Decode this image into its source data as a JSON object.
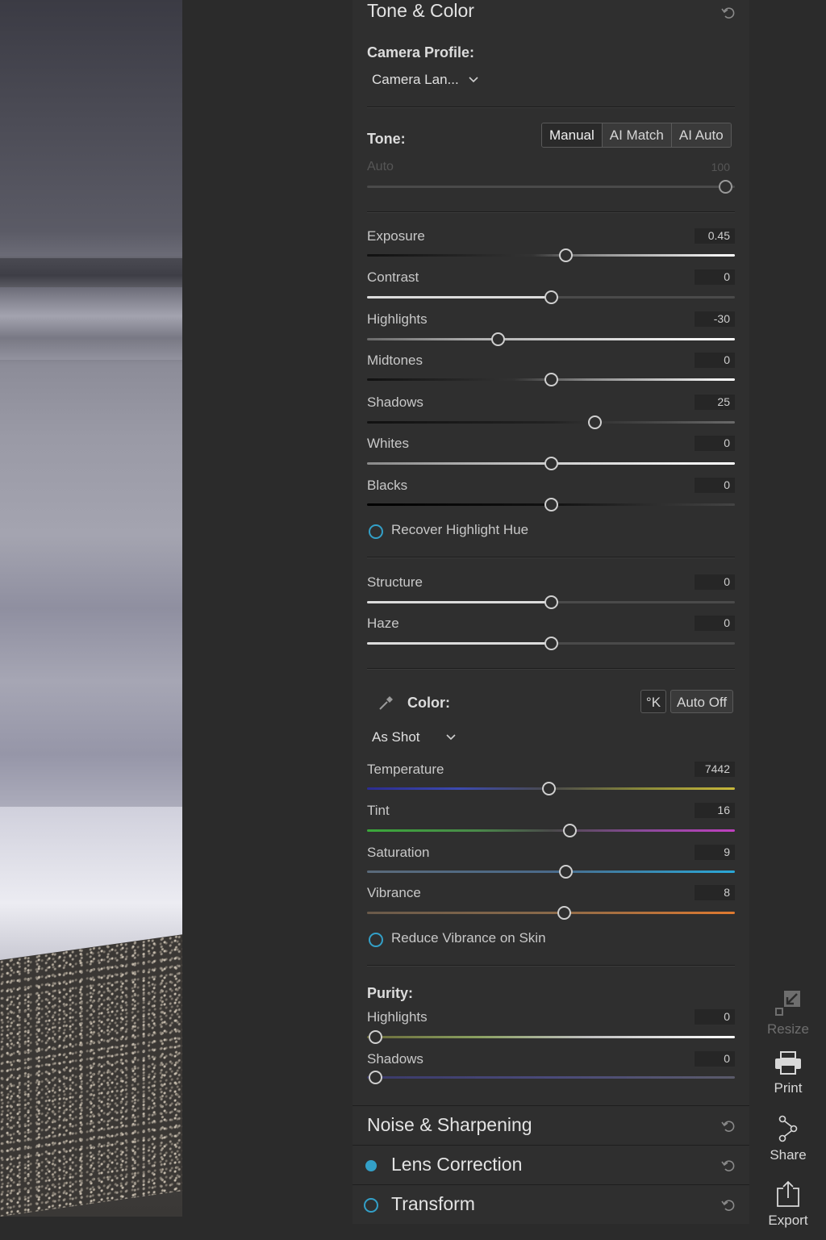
{
  "panel": {
    "title": "Tone & Color",
    "camera_profile_label": "Camera Profile:",
    "camera_profile_value": "Camera Lan...",
    "tone_label": "Tone:",
    "tone_modes": [
      "Manual",
      "AI Match",
      "AI Auto"
    ],
    "tone_mode_selected": "Manual",
    "auto_label": "Auto",
    "auto_value": "100",
    "tone_sliders": [
      {
        "label": "Exposure",
        "value": "0.45"
      },
      {
        "label": "Contrast",
        "value": "0"
      },
      {
        "label": "Highlights",
        "value": "-30"
      },
      {
        "label": "Midtones",
        "value": "0"
      },
      {
        "label": "Shadows",
        "value": "25"
      },
      {
        "label": "Whites",
        "value": "0"
      },
      {
        "label": "Blacks",
        "value": "0"
      }
    ],
    "recover_highlight_hue": "Recover Highlight Hue",
    "detail_sliders": [
      {
        "label": "Structure",
        "value": "0"
      },
      {
        "label": "Haze",
        "value": "0"
      }
    ],
    "color_label": "Color:",
    "kelvin_button": "°K",
    "auto_off_button": "Auto Off",
    "white_balance_value": "As Shot",
    "color_sliders": [
      {
        "label": "Temperature",
        "value": "7442"
      },
      {
        "label": "Tint",
        "value": "16"
      },
      {
        "label": "Saturation",
        "value": "9"
      },
      {
        "label": "Vibrance",
        "value": "8"
      }
    ],
    "reduce_vibrance_on_skin": "Reduce Vibrance on Skin",
    "purity_label": "Purity:",
    "purity_sliders": [
      {
        "label": "Highlights",
        "value": "0"
      },
      {
        "label": "Shadows",
        "value": "0"
      }
    ]
  },
  "collapsed_sections": [
    {
      "title": "Noise & Sharpening"
    },
    {
      "title": "Lens Correction"
    },
    {
      "title": "Transform"
    }
  ],
  "toolbar": {
    "resize": "Resize",
    "print": "Print",
    "share": "Share",
    "export": "Export"
  },
  "colors": {
    "accent": "#33a0c8",
    "panel_bg": "#2f2f2f",
    "app_bg": "#2b2b2b"
  }
}
